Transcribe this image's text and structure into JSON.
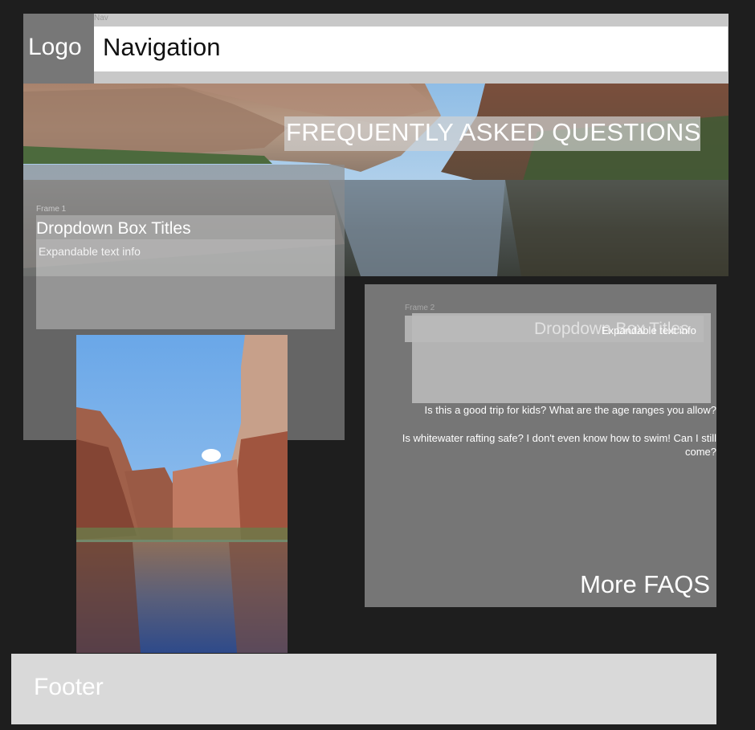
{
  "header": {
    "logo_label": "Logo",
    "nav_small_label": "Nav",
    "navigation_label": "Navigation"
  },
  "hero": {
    "heading": "FREQUENTLY ASKED QUESTIONS",
    "image": "river-canyon-photo"
  },
  "frame1": {
    "label": "Frame 1",
    "dropdown_title": "Dropdown Box Titles",
    "expandable_text": "Expandable text info"
  },
  "side_image": "canyon-river-photo",
  "frame2": {
    "label": "Frame 2",
    "dropdown_title": "Dropdown Box Titles",
    "expandable_text": "Expandable text info",
    "questions": [
      "Is this a good trip for kids? What are the age ranges you allow?",
      "Is whitewater rafting safe? I don't even know how to swim! Can I still come?"
    ],
    "more_link": "More FAQS"
  },
  "footer": {
    "label": "Footer"
  },
  "colors": {
    "background": "#1e1e1e",
    "frame_gray": "#767676",
    "footer_gray": "#d9d9d9",
    "nav_white": "#ffffff"
  }
}
